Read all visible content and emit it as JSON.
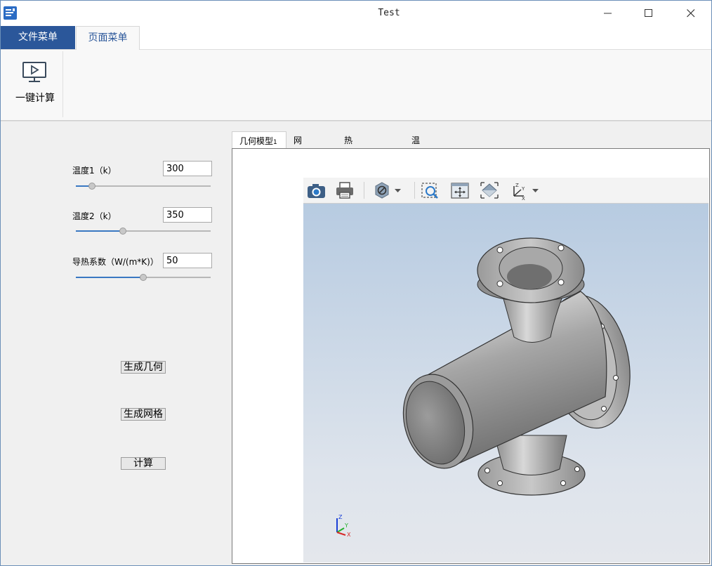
{
  "window": {
    "title": "Test"
  },
  "menu_tabs": {
    "file": "文件菜单",
    "page": "页面菜单"
  },
  "ribbon": {
    "calc_all_label": "一键计算"
  },
  "params": {
    "temp1": {
      "label": "温度1（k）",
      "value": "300",
      "slider_fraction": 0.12
    },
    "temp2": {
      "label": "温度2（k）",
      "value": "350",
      "slider_fraction": 0.35
    },
    "conductivity": {
      "label": "导热系数（W/(m*K)）",
      "value": "50",
      "slider_fraction": 0.5
    }
  },
  "buttons": {
    "gen_geometry": "生成几何",
    "gen_mesh": "生成网格",
    "compute": "计算"
  },
  "view_tabs": [
    "几何模型",
    "网格模型",
    "热流密度云图",
    "温度云图"
  ],
  "view_tab_suffix": "1",
  "axis_labels": {
    "x": "X",
    "y": "Y",
    "z": "Z"
  },
  "colors": {
    "accent": "#2b579a",
    "slider": "#3a78c2"
  }
}
